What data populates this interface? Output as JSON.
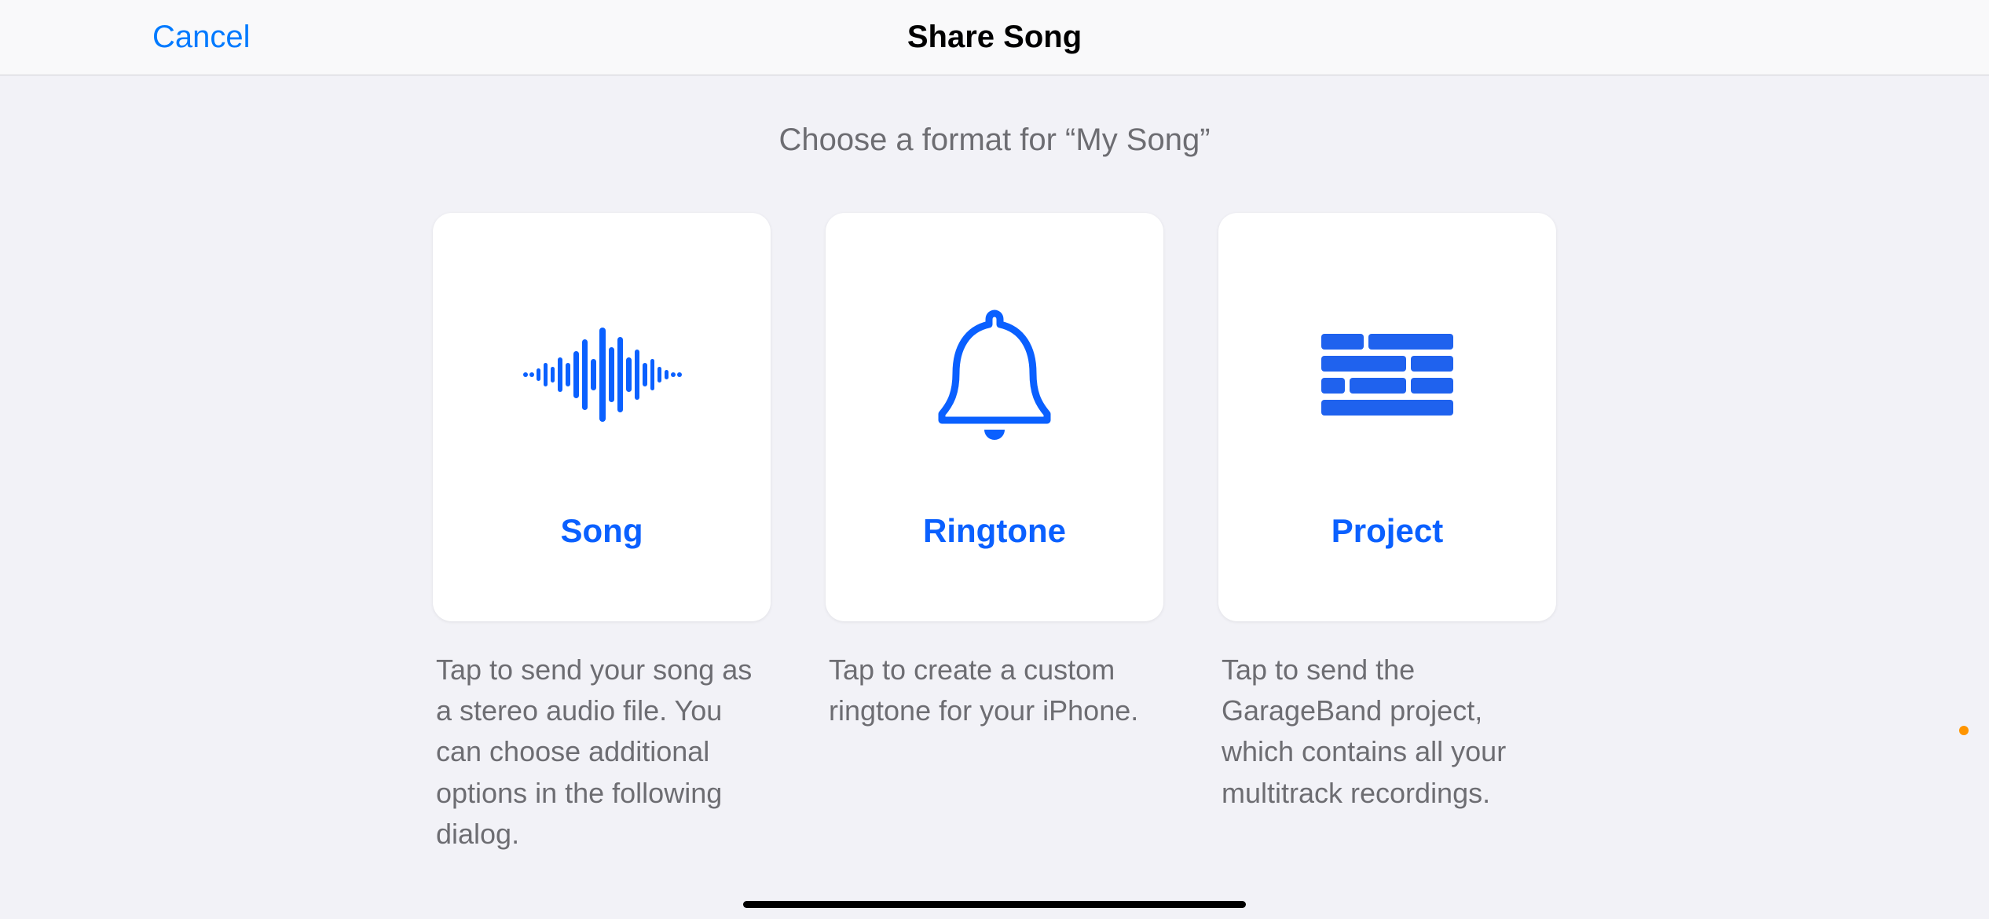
{
  "header": {
    "cancel_label": "Cancel",
    "title": "Share Song"
  },
  "prompt": "Choose a format for “My Song”",
  "options": [
    {
      "label": "Song",
      "description": "Tap to send your song as a stereo audio file. You can choose additional options in the following dialog."
    },
    {
      "label": "Ringtone",
      "description": "Tap to create a custom ringtone for your iPhone."
    },
    {
      "label": "Project",
      "description": "Tap to send the GarageBand project, which contains all your multitrack recordings."
    }
  ]
}
